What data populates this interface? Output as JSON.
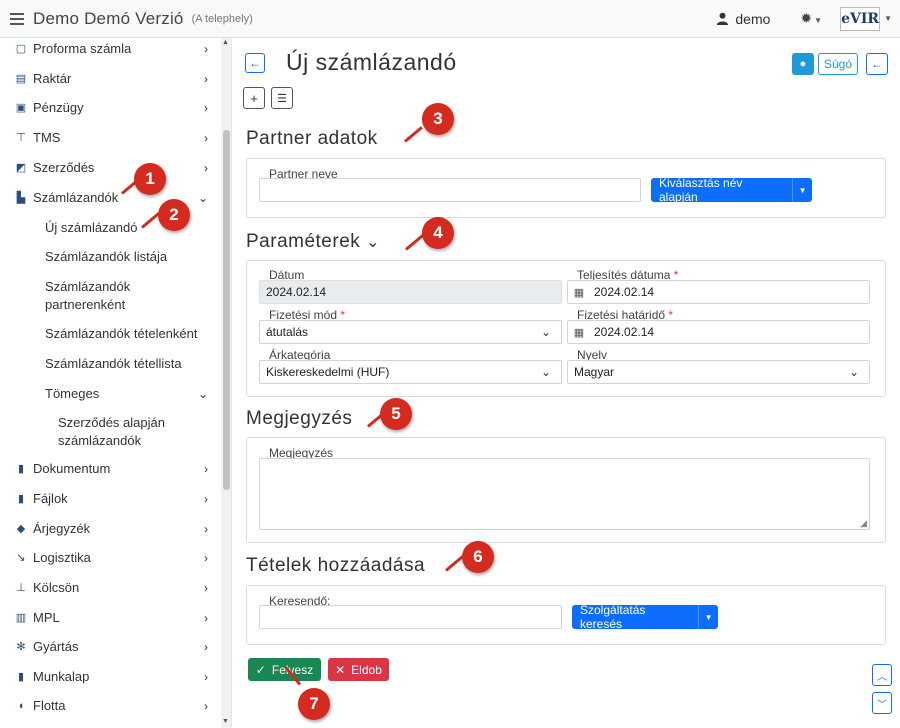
{
  "app": {
    "title": "Demo Demó Verzió",
    "subtitle": "(A telephely)",
    "user": "demo",
    "logo_text": "eVIR"
  },
  "sidebar": {
    "items": [
      {
        "label": "Proforma számla",
        "icon": "document-icon"
      },
      {
        "label": "Raktár",
        "icon": "warehouse-icon"
      },
      {
        "label": "Pénzügy",
        "icon": "money-icon"
      },
      {
        "label": "TMS",
        "icon": "pin-icon"
      },
      {
        "label": "Szerződés",
        "icon": "contract-icon"
      },
      {
        "label": "Számlázandók",
        "icon": "invoice-icon"
      },
      {
        "label": "Dokumentum",
        "icon": "file-icon"
      },
      {
        "label": "Fájlok",
        "icon": "files-icon"
      },
      {
        "label": "Árjegyzék",
        "icon": "tag-icon"
      },
      {
        "label": "Logisztika",
        "icon": "logistics-icon"
      },
      {
        "label": "Kölcsön",
        "icon": "loan-icon"
      },
      {
        "label": "MPL",
        "icon": "truck-icon"
      },
      {
        "label": "Gyártás",
        "icon": "cogs-icon"
      },
      {
        "label": "Munkalap",
        "icon": "worksheet-icon"
      },
      {
        "label": "Flotta",
        "icon": "car-icon"
      }
    ],
    "subitems": [
      "Új számlázandó",
      "Számlázandók listája",
      "Számlázandók partnerenként",
      "Számlázandók tételenként",
      "Számlázandók tétellista",
      "Tömeges"
    ],
    "subsubitems": [
      "Szerződés alapján számlázandók"
    ]
  },
  "page": {
    "title": "Új számlázandó",
    "help_label": "Súgó"
  },
  "partner": {
    "section_title": "Partner adatok",
    "name_label": "Partner neve",
    "name_value": "",
    "select_button": "Kiválasztás név alapján"
  },
  "params": {
    "section_title": "Paraméterek",
    "date_label": "Dátum",
    "date_value": "2024.02.14",
    "completion_label": "Teljesítés dátuma",
    "completion_value": "2024.02.14",
    "payment_label": "Fizetési mód",
    "payment_value": "átutalás",
    "deadline_label": "Fizetési határidő",
    "deadline_value": "2024.02.14",
    "price_category_label": "Árkategória",
    "price_category_value": "Kiskereskedelmi (HUF)",
    "language_label": "Nyelv",
    "language_value": "Magyar",
    "required_mark": "*"
  },
  "note": {
    "section_title": "Megjegyzés",
    "field_label": "Megjegyzés"
  },
  "items": {
    "section_title": "Tételek hozzáadása",
    "search_label": "Keresendő:",
    "search_button": "Szolgáltatás keresés"
  },
  "actions": {
    "ok": "Felvesz",
    "cancel": "Eldob"
  },
  "markers": [
    "1",
    "2",
    "3",
    "4",
    "5",
    "6",
    "7"
  ],
  "colors": {
    "primary": "#0d6efd",
    "success": "#198754",
    "danger": "#dc3545",
    "info": "#1e9bd7",
    "marker": "#d42a1f"
  }
}
